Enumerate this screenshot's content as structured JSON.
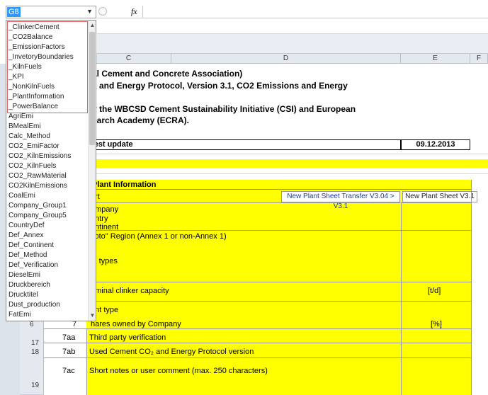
{
  "namebox": {
    "value": "G8"
  },
  "formula_bar": {
    "fx_label": "fx"
  },
  "columns": [
    "C",
    "D",
    "E",
    "F"
  ],
  "header": {
    "line1": "al Cement and Concrete Association)",
    "line2": "2 and Energy Protocol, Version 3.1, CO2 Emissions and Energy",
    "line3": "y the WBCSD Cement Sustainability Initiative (CSI) and European",
    "line4": "earch Academy (ECRA)."
  },
  "latest_update": {
    "label": "test update",
    "date": "09.12.2013"
  },
  "section_title": "Plant Information",
  "rows": {
    "r_port": "ort",
    "r_company": "ompany",
    "r_country": "untry",
    "r_continent": "ontinent",
    "r_region": "yoto\" Region (Annex 1 or non-Annex 1)",
    "r_types": "in types",
    "r_capacity": "ominal clinker capacity",
    "r_capacity_unit": "[t/d]",
    "r_planttype": "ant type",
    "r_shares": "hares owned by Company",
    "r_shares_unit": "[%]",
    "r_7aa_num": "7aa",
    "r_7aa": "Third party verification",
    "r_7ab_num": "7ab",
    "r_7ab": "Used Cement CO₂ and Energy Protocol version",
    "r_7ac_num": "7ac",
    "r_7ac": "Short notes or user comment (max. 250 characters)",
    "r_7_num": "7"
  },
  "buttons": {
    "transfer": "New Plant Sheet Transfer V3.04 > V3.1",
    "new_sheet": "New Plant Sheet V3.1"
  },
  "row_numbers": {
    "r6": "6",
    "r17": "17",
    "r18": "18",
    "r19": "19"
  },
  "dropdown_items": [
    "_ClinkerCement",
    "_CO2Balance",
    "_EmissionFactors",
    "_InvetoryBoundaries",
    "_KilnFuels",
    "_KPI",
    "_NonKilnFuels",
    "_PlantInformation",
    "_PowerBalance",
    "AgriEmi",
    "BMealEmi",
    "Calc_Method",
    "CO2_EmiFactor",
    "CO2_KilnEmissions",
    "CO2_KilnFuels",
    "CO2_RawMaterial",
    "CO2KilnEmissions",
    "CoalEmi",
    "Company_Group1",
    "Company_Group5",
    "CountryDef",
    "Def_Annex",
    "Def_Continent",
    "Def_Method",
    "Def_Verification",
    "DieselEmi",
    "Druckbereich",
    "Drucktitel",
    "Dust_production",
    "FatEmi"
  ]
}
